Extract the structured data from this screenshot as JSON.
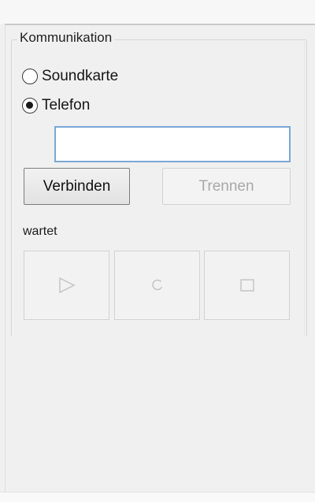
{
  "group": {
    "title": "Kommunikation"
  },
  "radios": [
    {
      "label": "Soundkarte",
      "checked": false
    },
    {
      "label": "Telefon",
      "checked": true
    }
  ],
  "phone_input": {
    "value": "",
    "placeholder": ""
  },
  "buttons": {
    "connect_label": "Verbinden",
    "disconnect_label": "Trennen"
  },
  "status": {
    "text": "wartet"
  },
  "media_controls": [
    {
      "icon": "play-icon",
      "enabled": false
    },
    {
      "icon": "record-icon",
      "enabled": false
    },
    {
      "icon": "stop-icon",
      "enabled": false
    }
  ],
  "colors": {
    "input_border": "#7aa7d6",
    "disabled_text": "#a8a8a8"
  }
}
